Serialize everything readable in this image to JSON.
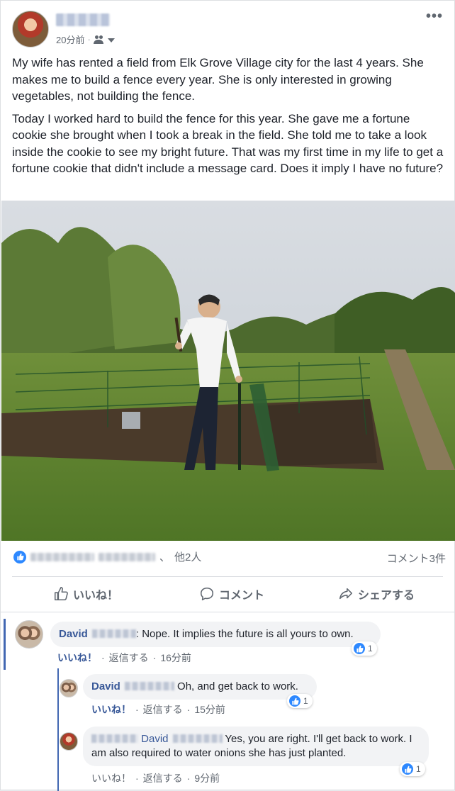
{
  "post": {
    "time": "20分前",
    "separator": "·",
    "paragraphs": [
      "My wife has rented a field from Elk Grove Village city for the last 4 years. She makes me to build a fence every year. She is only interested in growing vegetables, not building the fence.",
      "Today I worked hard to build the fence for this year. She gave me a fortune cookie she brought when I took a break in the field. She told me to take a look inside the cookie to see my bright future. That was my first time in my life to get a fortune cookie that didn't include a message card. Does it imply I have no future?"
    ]
  },
  "reactions": {
    "separator": "、",
    "others": "他2人",
    "comment_count": "コメント3件"
  },
  "actions": {
    "like": "いいね！",
    "comment": "コメント",
    "share": "シェアする"
  },
  "comments": [
    {
      "author": "David",
      "text": ": Nope. It implies the future is all yours to own.",
      "like_label": "いいね！",
      "reply_label": "返信する",
      "time": "16分前",
      "reaction_count": "1"
    },
    {
      "author": "David",
      "text": " Oh, and get back to work.",
      "like_label": "いいね！",
      "reply_label": "返信する",
      "time": "15分前",
      "reaction_count": "1"
    },
    {
      "tag": "David",
      "text": " Yes, you are right. I'll get back to work. I am also required to water onions she has just planted.",
      "like_label": "いいね！",
      "reply_label": "返信する",
      "time": "9分前",
      "reaction_count": "1"
    }
  ],
  "colors": {
    "link": "#385898",
    "like_blue": "#2d88ff",
    "thread_line": "#4267b2",
    "bubble": "#f2f3f5"
  },
  "icons": [
    "audience-icon",
    "caret-down-icon",
    "more-icon",
    "like-icon",
    "comment-icon",
    "share-icon",
    "like-reaction-icon"
  ]
}
